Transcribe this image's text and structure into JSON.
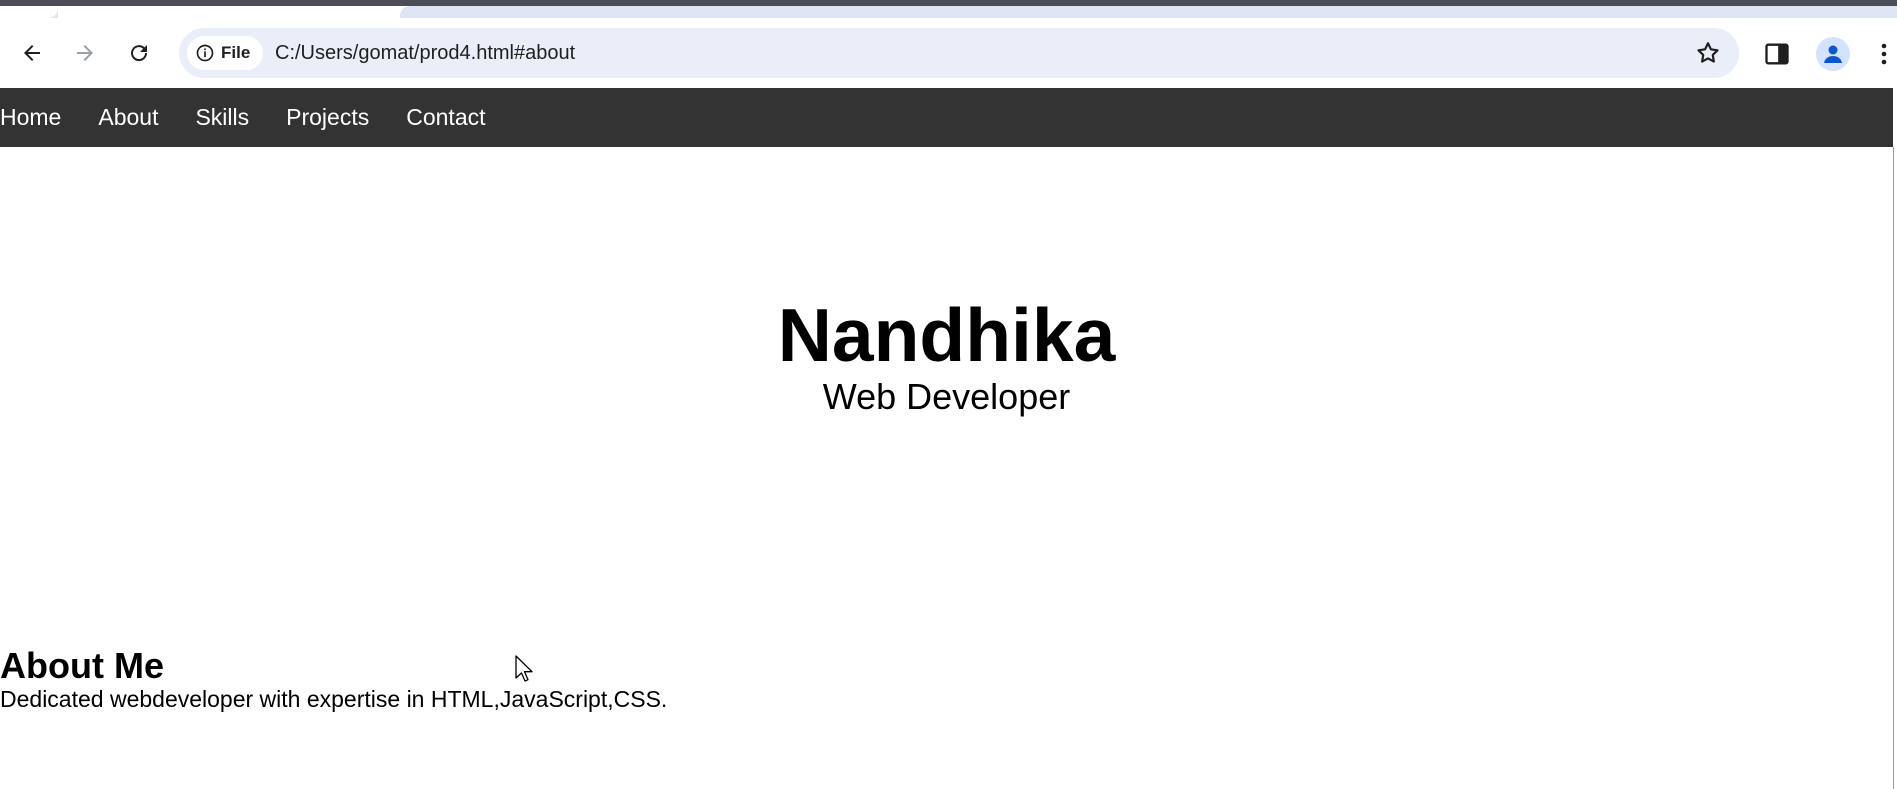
{
  "browser": {
    "chip_label": "File",
    "url": "C:/Users/gomat/prod4.html#about",
    "icons": {
      "back": "back-arrow-icon",
      "forward": "forward-arrow-icon",
      "reload": "reload-icon",
      "info": "info-icon",
      "bookmark": "star-icon",
      "side_panel": "side-panel-icon",
      "profile": "profile-avatar-icon",
      "menu": "more-vert-icon"
    }
  },
  "nav": {
    "items": [
      {
        "label": "Home"
      },
      {
        "label": "About"
      },
      {
        "label": "Skills"
      },
      {
        "label": "Projects"
      },
      {
        "label": "Contact"
      }
    ],
    "background": "#333333"
  },
  "hero": {
    "name": "Nandhika",
    "role": "Web Developer"
  },
  "about": {
    "heading": "About Me",
    "text": "Dedicated webdeveloper with expertise in HTML,JavaScript,CSS."
  }
}
